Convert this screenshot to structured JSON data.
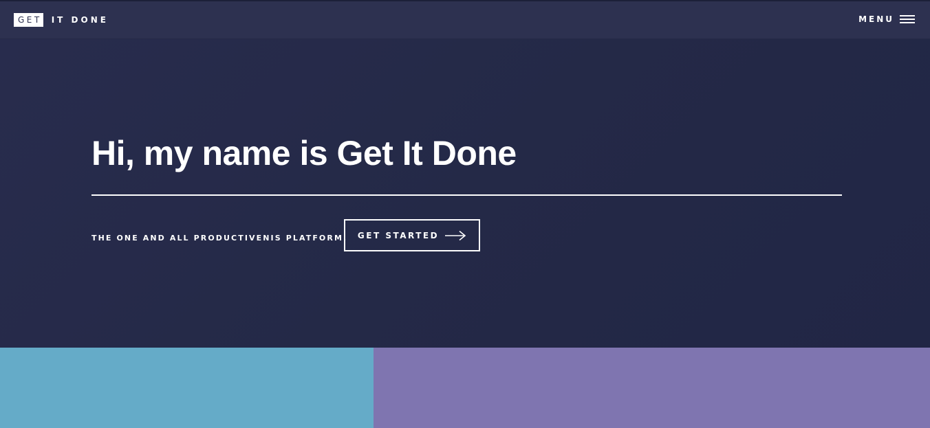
{
  "nav": {
    "logo_box": "GET",
    "logo_rest": "IT DONE",
    "menu_label": "MENU",
    "menu_icon": "hamburger-icon"
  },
  "hero": {
    "headline": "Hi, my name is Get It Done",
    "tagline": "THE ONE AND ALL PRODUCTIVENIS PLATFORM.",
    "cta_label": "GET STARTED",
    "cta_icon": "arrow-right-icon"
  },
  "colors": {
    "navbar": "#2d3150",
    "hero_background": "#252a48",
    "panel_left": "#65abc8",
    "panel_right": "#7f75b0",
    "text": "#ffffff"
  }
}
